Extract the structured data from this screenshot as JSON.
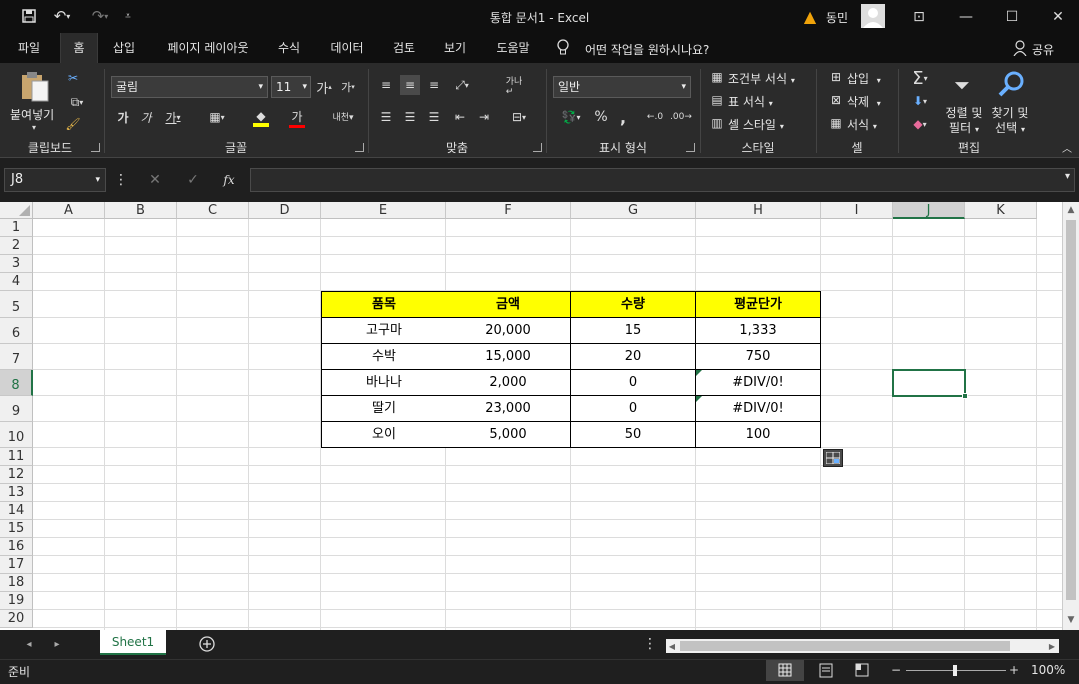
{
  "titlebar": {
    "doc_title": "통합 문서1  -  Excel",
    "user_name": "동민",
    "warning_icon": "warning-icon",
    "qat": [
      "save-icon",
      "undo-icon",
      "redo-icon",
      "customize-icon"
    ]
  },
  "tabs": [
    {
      "label": "파일",
      "active": false
    },
    {
      "label": "홈",
      "active": true
    },
    {
      "label": "삽입",
      "active": false
    },
    {
      "label": "페이지 레이아웃",
      "active": false
    },
    {
      "label": "수식",
      "active": false
    },
    {
      "label": "데이터",
      "active": false
    },
    {
      "label": "검토",
      "active": false
    },
    {
      "label": "보기",
      "active": false
    },
    {
      "label": "도움말",
      "active": false
    }
  ],
  "tell_me": "어떤 작업을 원하시나요?",
  "share_label": "공유",
  "ribbon": {
    "clipboard": {
      "paste_label": "붙여넣기",
      "group_label": "클립보드"
    },
    "font": {
      "font_name": "굴림",
      "font_size": "11",
      "group_label": "글꼴"
    },
    "alignment": {
      "group_label": "맞춤"
    },
    "number": {
      "format": "일반",
      "group_label": "표시 형식",
      "percent": "%",
      "comma": ","
    },
    "styles": {
      "conditional": "조건부 서식",
      "table": "표 서식",
      "cell_styles": "셀 스타일",
      "group_label": "스타일"
    },
    "cells": {
      "insert": "삽입",
      "delete": "삭제",
      "format": "서식",
      "group_label": "셀"
    },
    "editing": {
      "sort_filter_1": "정렬 및",
      "sort_filter_2": "필터",
      "find_select_1": "찾기 및",
      "find_select_2": "선택",
      "group_label": "편집"
    }
  },
  "formula_bar": {
    "name_box": "J8",
    "formula": "",
    "fx": "fx"
  },
  "sheet": {
    "columns": [
      "A",
      "B",
      "C",
      "D",
      "E",
      "F",
      "G",
      "H",
      "I",
      "J",
      "K"
    ],
    "rows": [
      "1",
      "2",
      "3",
      "4",
      "5",
      "6",
      "7",
      "8",
      "9",
      "10",
      "11",
      "12",
      "13",
      "14",
      "15",
      "16",
      "17",
      "18",
      "19",
      "20"
    ],
    "selected_cell": "J8",
    "table": {
      "headers": [
        "품목",
        "금액",
        "수량",
        "평균단가"
      ],
      "rows": [
        [
          "고구마",
          "20,000",
          "15",
          "1,333"
        ],
        [
          "수박",
          "15,000",
          "20",
          "750"
        ],
        [
          "바나나",
          "2,000",
          "0",
          "#DIV/0!"
        ],
        [
          "딸기",
          "23,000",
          "0",
          "#DIV/0!"
        ],
        [
          "오이",
          "5,000",
          "50",
          "100"
        ]
      ]
    }
  },
  "sheet_tabs": [
    {
      "label": "Sheet1",
      "active": true
    }
  ],
  "status": {
    "ready": "준비",
    "zoom": "100%"
  },
  "colors": {
    "accent": "#217346",
    "header_fill": "#ffff00"
  }
}
